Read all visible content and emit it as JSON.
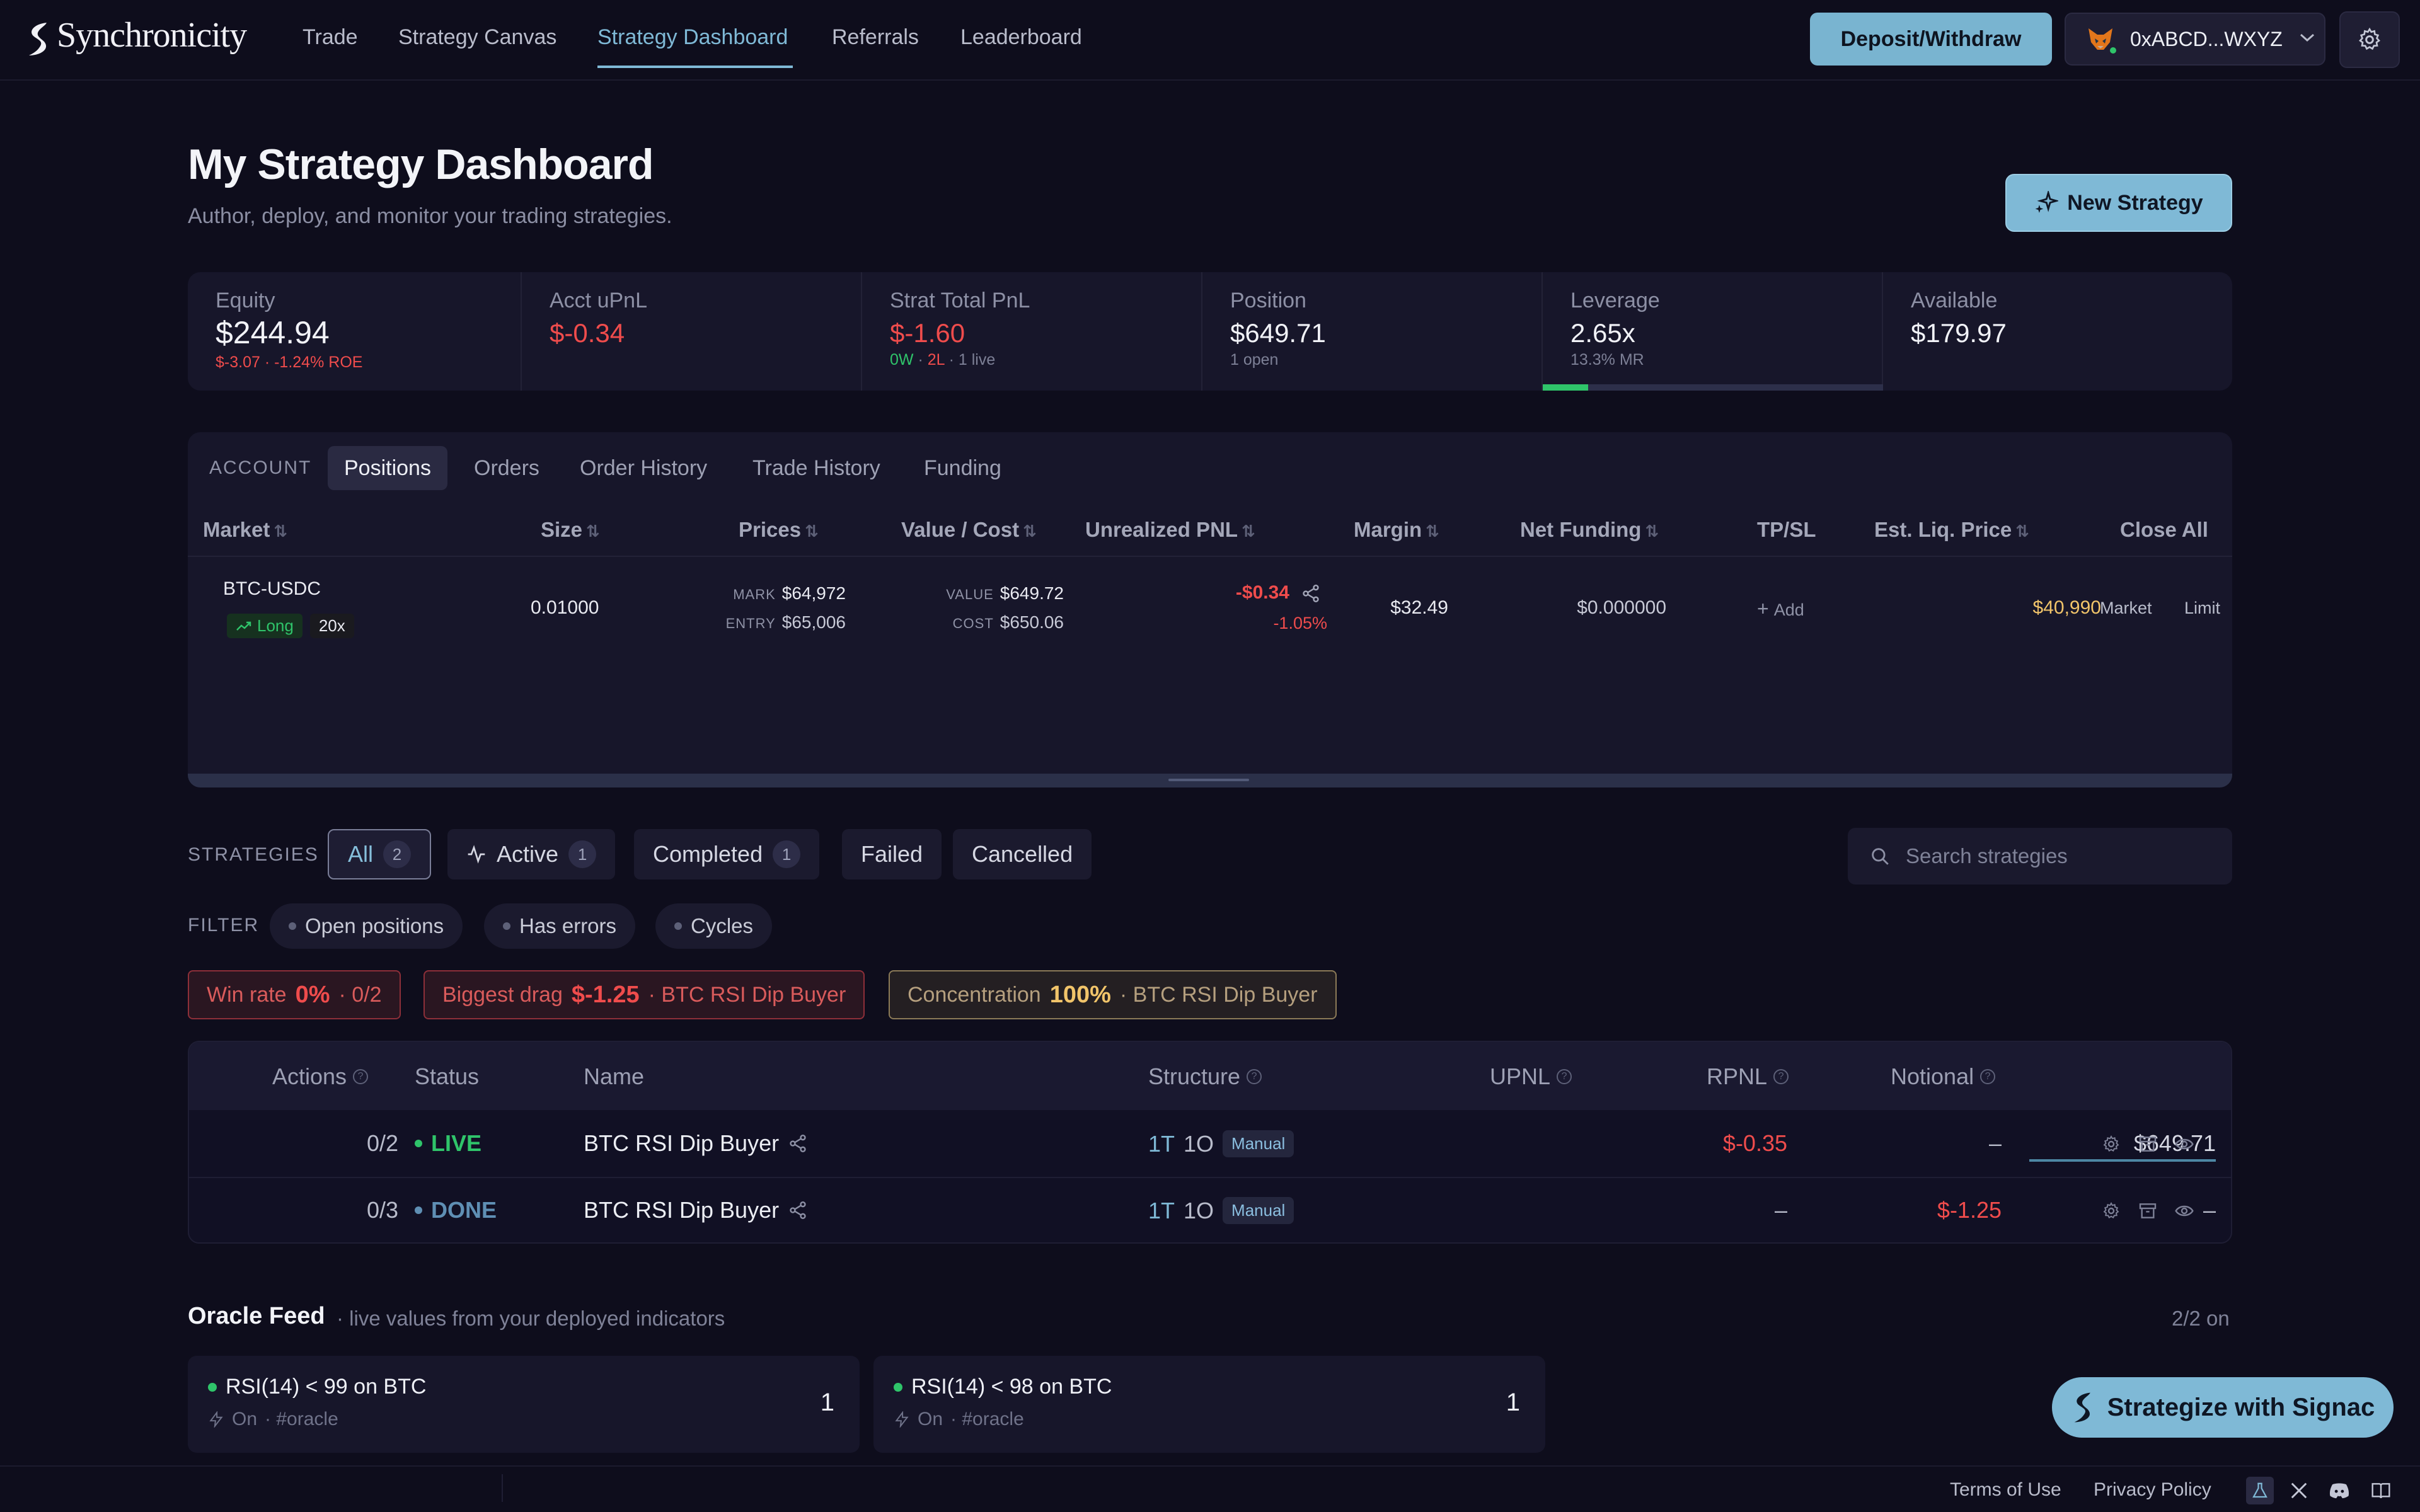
{
  "nav": {
    "brand": "Synchronicity",
    "links": [
      "Trade",
      "Strategy Canvas",
      "Strategy Dashboard",
      "Referrals",
      "Leaderboard"
    ],
    "active_link": "Strategy Dashboard",
    "deposit_label": "Deposit/Withdraw",
    "wallet_address": "0xABCD...WXYZ"
  },
  "header": {
    "title": "My Strategy Dashboard",
    "subtitle": "Author, deploy, and monitor your trading strategies.",
    "new_strategy_label": "New Strategy"
  },
  "stats": {
    "equity": {
      "label": "Equity",
      "value": "$244.94",
      "sub": "$-3.07 · -1.24% ROE"
    },
    "acct_upnl": {
      "label": "Acct uPnL",
      "value": "$-0.34"
    },
    "strat_pnl": {
      "label": "Strat Total PnL",
      "value": "$-1.60",
      "sub_w": "0W",
      "sub_l": "2L",
      "sub_live": "1 live"
    },
    "position": {
      "label": "Position",
      "value": "$649.71",
      "sub": "1 open"
    },
    "leverage": {
      "label": "Leverage",
      "value": "2.65x",
      "sub": "13.3% MR",
      "bar_fraction": 0.133
    },
    "available": {
      "label": "Available",
      "value": "$179.97"
    }
  },
  "account": {
    "label": "ACCOUNT",
    "tabs": [
      "Positions",
      "Orders",
      "Order History",
      "Trade History",
      "Funding"
    ],
    "active_tab": "Positions",
    "columns": [
      "Market",
      "Size",
      "Prices",
      "Value / Cost",
      "Unrealized PNL",
      "Margin",
      "Net Funding",
      "TP/SL",
      "Est. Liq. Price",
      "Close All"
    ],
    "positions": [
      {
        "market": "BTC-USDC",
        "side": "Long",
        "leverage": "20x",
        "size": "0.01000",
        "mark_label": "MARK",
        "mark": "$64,972",
        "entry_label": "ENTRY",
        "entry": "$65,006",
        "value_label": "VALUE",
        "value": "$649.72",
        "cost_label": "COST",
        "cost": "$650.06",
        "upnl": "-$0.34",
        "upnl_pct": "-1.05%",
        "margin": "$32.49",
        "net_funding": "$0.000000",
        "tpsl": "Add",
        "liq_price": "$40,990",
        "close_market": "Market",
        "close_limit": "Limit"
      }
    ]
  },
  "strategies": {
    "label": "STRATEGIES",
    "tabs": [
      {
        "label": "All",
        "count": "2"
      },
      {
        "label": "Active",
        "count": "1"
      },
      {
        "label": "Completed",
        "count": "1"
      },
      {
        "label": "Failed"
      },
      {
        "label": "Cancelled"
      }
    ],
    "search_placeholder": "Search strategies",
    "filter_label": "FILTER",
    "filters": [
      "Open positions",
      "Has errors",
      "Cycles"
    ],
    "insights": {
      "win_rate": {
        "label": "Win rate",
        "value": "0%",
        "detail": "· 0/2"
      },
      "biggest_drag": {
        "label": "Biggest drag",
        "value": "$-1.25",
        "detail": "· BTC RSI Dip Buyer"
      },
      "concentration": {
        "label": "Concentration",
        "value": "100%",
        "detail": "· BTC RSI Dip Buyer"
      }
    },
    "columns": [
      "Actions",
      "Status",
      "Name",
      "Structure",
      "UPNL",
      "RPNL",
      "Notional"
    ],
    "rows": [
      {
        "actions": "0/2",
        "status": "LIVE",
        "name": "BTC RSI Dip Buyer",
        "s_t": "1T",
        "s_o": "1O",
        "mode": "Manual",
        "upnl": "$-0.35",
        "rpnl": "–",
        "notional": "$649.71"
      },
      {
        "actions": "0/3",
        "status": "DONE",
        "name": "BTC RSI Dip Buyer",
        "s_t": "1T",
        "s_o": "1O",
        "mode": "Manual",
        "upnl": "–",
        "rpnl": "$-1.25",
        "notional": "–"
      }
    ]
  },
  "oracle": {
    "title": "Oracle Feed",
    "subtitle": "· live values from your deployed indicators",
    "count": "2/2 on",
    "cards": [
      {
        "title": "RSI(14) < 99 on BTC",
        "state": "On",
        "tag": "· #oracle",
        "value": "1"
      },
      {
        "title": "RSI(14) < 98 on BTC",
        "state": "On",
        "tag": "· #oracle",
        "value": "1"
      }
    ]
  },
  "signac_label": "Strategize with Signac",
  "footer": {
    "terms": "Terms of Use",
    "privacy": "Privacy Policy"
  },
  "colors": {
    "accent": "#7fb9d6",
    "negative": "#ef4c4c",
    "positive": "#2fc46a",
    "liq": "#f1c46a",
    "background": "#0e0d1c"
  }
}
